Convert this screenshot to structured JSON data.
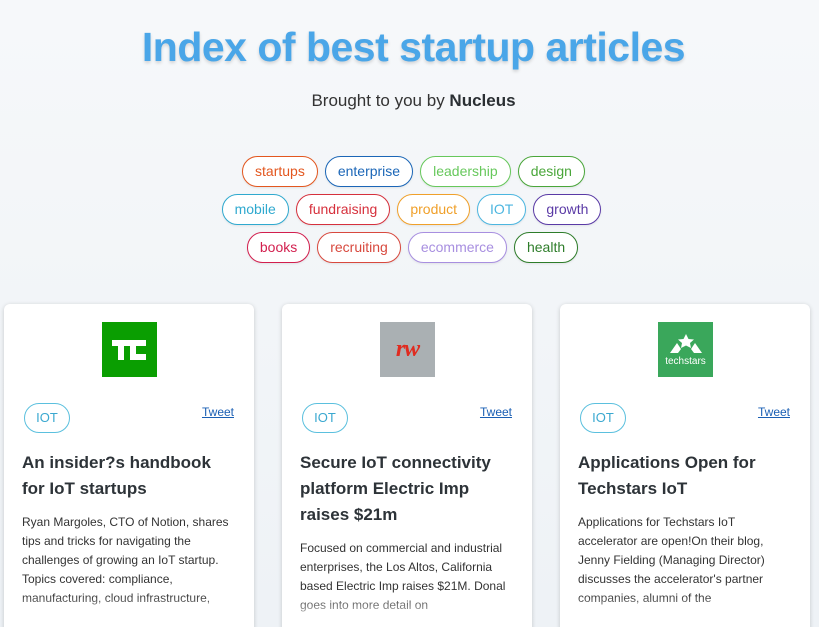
{
  "header": {
    "title": "Index of best startup articles",
    "subtitle_prefix": "Brought to you by ",
    "subtitle_brand": "Nucleus"
  },
  "tags": [
    [
      {
        "label": "startups",
        "color": "#e3571f"
      },
      {
        "label": "enterprise",
        "color": "#1b66b7"
      },
      {
        "label": "leadership",
        "color": "#67c85c"
      },
      {
        "label": "design",
        "color": "#4aa63a"
      }
    ],
    [
      {
        "label": "mobile",
        "color": "#2fa9cf"
      },
      {
        "label": "fundraising",
        "color": "#d6303c"
      },
      {
        "label": "product",
        "color": "#f0a02a"
      },
      {
        "label": "IOT",
        "color": "#4cb6e0"
      },
      {
        "label": "growth",
        "color": "#5a3aa6"
      }
    ],
    [
      {
        "label": "books",
        "color": "#d21f4e"
      },
      {
        "label": "recruiting",
        "color": "#d8493e"
      },
      {
        "label": "ecommerce",
        "color": "#a88fe0"
      },
      {
        "label": "health",
        "color": "#2e7d2a"
      }
    ]
  ],
  "cards": [
    {
      "logo": "TC",
      "tag": "IOT",
      "tweet": "Tweet",
      "title": "An insider?s handbook for IoT startups",
      "body": "Ryan Margoles, CTO of Notion, shares tips and tricks for navigating the challenges of growing an IoT startup. Topics covered: compliance, manufacturing, cloud infrastructure,"
    },
    {
      "logo": "rw",
      "tag": "IOT",
      "tweet": "Tweet",
      "title": "Secure IoT connectivity platform Electric Imp raises $21m",
      "body": "Focused on commercial and industrial enterprises, the Los Altos, California based Electric Imp raises $21M. Donal goes into more detail on"
    },
    {
      "logo": "techstars",
      "tag": "IOT",
      "tweet": "Tweet",
      "title": "Applications Open for Techstars IoT",
      "body": "Applications for Techstars IoT accelerator are open!On their blog, Jenny Fielding (Managing Director) discusses the accelerator's partner companies, alumni of the"
    }
  ]
}
